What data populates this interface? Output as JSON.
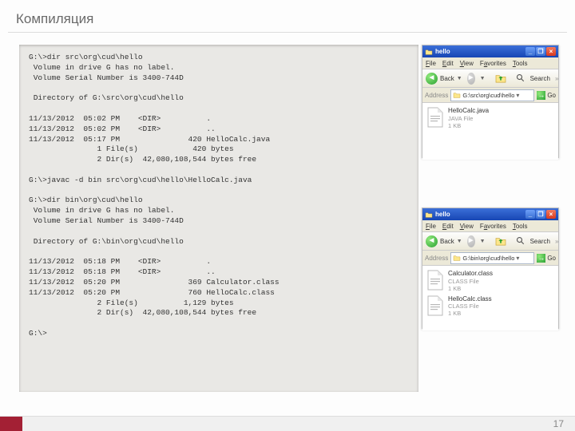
{
  "title": "Компиляция",
  "page_number": "17",
  "terminal": {
    "content": "G:\\>dir src\\org\\cud\\hello\n Volume in drive G has no label.\n Volume Serial Number is 3400-744D\n\n Directory of G:\\src\\org\\cud\\hello\n\n11/13/2012  05:02 PM    <DIR>          .\n11/13/2012  05:02 PM    <DIR>          ..\n11/13/2012  05:17 PM               420 HelloCalc.java\n               1 File(s)            420 bytes\n               2 Dir(s)  42,080,108,544 bytes free\n\nG:\\>javac -d bin src\\org\\cud\\hello\\HelloCalc.java\n\nG:\\>dir bin\\org\\cud\\hello\n Volume in drive G has no label.\n Volume Serial Number is 3400-744D\n\n Directory of G:\\bin\\org\\cud\\hello\n\n11/13/2012  05:18 PM    <DIR>          .\n11/13/2012  05:18 PM    <DIR>          ..\n11/13/2012  05:20 PM               369 Calculator.class\n11/13/2012  05:20 PM               760 HelloCalc.class\n               2 File(s)          1,129 bytes\n               2 Dir(s)  42,080,108,544 bytes free\n\nG:\\>"
  },
  "explorer_common": {
    "menu": {
      "file": "File",
      "edit": "Edit",
      "view": "View",
      "favorites": "Favorites",
      "tools": "Tools"
    },
    "toolbar": {
      "back": "Back",
      "search": "Search"
    },
    "address_label": "Address",
    "go_label": "Go",
    "win": {
      "min": "_",
      "max": "❐",
      "close": "×"
    }
  },
  "explorer1": {
    "title": "hello",
    "path": "G:\\src\\org\\cud\\hello",
    "files": [
      {
        "name": "HelloCalc.java",
        "type": "JAVA File",
        "size": "1 KB"
      }
    ]
  },
  "explorer2": {
    "title": "hello",
    "path": "G:\\bin\\org\\cud\\hello",
    "files": [
      {
        "name": "Calculator.class",
        "type": "CLASS File",
        "size": "1 KB"
      },
      {
        "name": "HelloCalc.class",
        "type": "CLASS File",
        "size": "1 KB"
      }
    ]
  }
}
